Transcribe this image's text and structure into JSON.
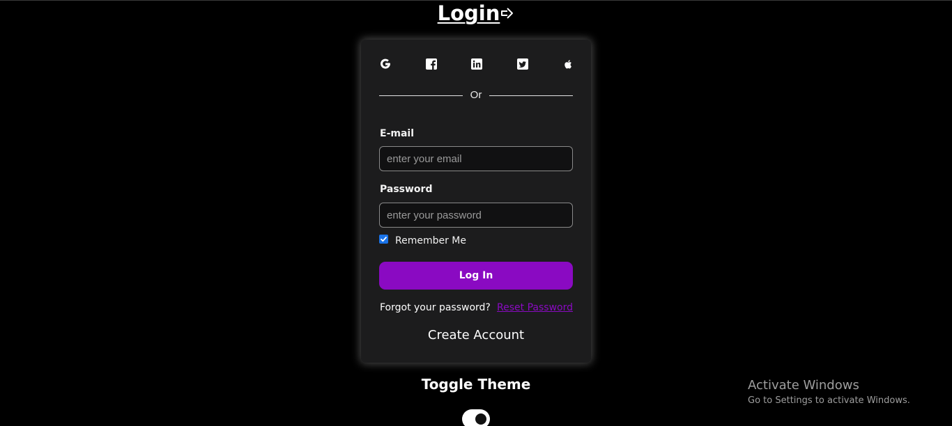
{
  "page": {
    "title": "Login",
    "title_icon": "login-arrow-icon"
  },
  "social": {
    "providers": [
      {
        "name": "Google",
        "icon": "google-icon"
      },
      {
        "name": "Facebook",
        "icon": "facebook-icon"
      },
      {
        "name": "LinkedIn",
        "icon": "linkedin-icon"
      },
      {
        "name": "Twitter",
        "icon": "twitter-icon"
      },
      {
        "name": "Apple",
        "icon": "apple-icon"
      }
    ]
  },
  "divider": {
    "text": "Or"
  },
  "form": {
    "email_label": "E-mail",
    "email_placeholder": "enter your email",
    "email_value": "",
    "password_label": "Password",
    "password_placeholder": "enter your password",
    "password_value": "",
    "remember_label": "Remember Me",
    "remember_checked": true,
    "login_label": "Log In",
    "forgot_text": "Forgot your password?",
    "reset_link": "Reset Password",
    "create_account": "Create Account"
  },
  "theme": {
    "toggle_label": "Toggle Theme",
    "toggle_on": true
  },
  "watermark": {
    "line1": "Activate Windows",
    "line2": "Go to Settings to activate Windows."
  },
  "colors": {
    "background": "#000000",
    "card": "#1c1c1d",
    "accent": "#8a0ac2",
    "checkbox": "#1a73e8"
  }
}
